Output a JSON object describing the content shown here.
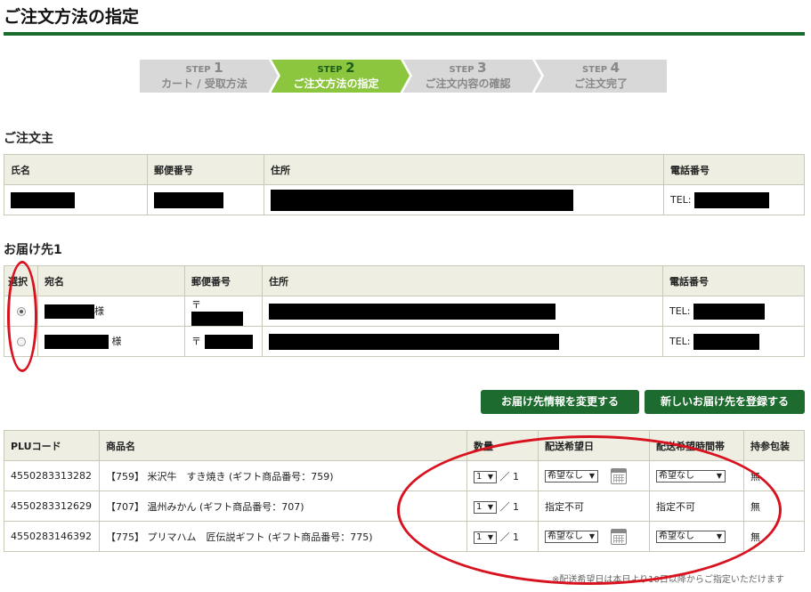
{
  "page": {
    "title": "ご注文方法の指定"
  },
  "steps": [
    {
      "label": "STEP",
      "num": "1",
      "name": "カート / 受取方法",
      "active": false
    },
    {
      "label": "STEP",
      "num": "2",
      "name": "ご注文方法の指定",
      "active": true
    },
    {
      "label": "STEP",
      "num": "3",
      "name": "ご注文内容の確認",
      "active": false
    },
    {
      "label": "STEP",
      "num": "4",
      "name": "ご注文完了",
      "active": false
    }
  ],
  "orderer": {
    "title": "ご注文主",
    "headers": {
      "name": "氏名",
      "zip": "郵便番号",
      "address": "住所",
      "phone": "電話番号"
    },
    "phone_prefix": "TEL:"
  },
  "delivery": {
    "title": "お届け先1",
    "headers": {
      "select": "選択",
      "name": "宛名",
      "zip": "郵便番号",
      "address": "住所",
      "phone": "電話番号"
    },
    "rows": [
      {
        "suffix": "様",
        "zip_prefix": "〒",
        "phone_prefix": "TEL:",
        "selected": true
      },
      {
        "suffix": "様",
        "zip_prefix": "〒",
        "phone_prefix": "TEL:",
        "selected": false
      }
    ]
  },
  "buttons": {
    "change": "お届け先情報を変更する",
    "new": "新しいお届け先を登録する"
  },
  "items": {
    "headers": {
      "plu": "PLUコード",
      "name": "商品名",
      "qty": "数量",
      "date": "配送希望日",
      "time": "配送希望時間帯",
      "wrap": "持参包装"
    },
    "rows": [
      {
        "plu": "4550283313282",
        "name": "【759】 米沢牛　すき焼き (ギフト商品番号：759)",
        "qty": "1",
        "qty_total": "／ 1",
        "date": "希望なし",
        "time": "希望なし",
        "wrap": "無",
        "selectable": true
      },
      {
        "plu": "4550283312629",
        "name": "【707】 温州みかん (ギフト商品番号：707)",
        "qty": "1",
        "qty_total": "／ 1",
        "date": "指定不可",
        "time": "指定不可",
        "wrap": "無",
        "selectable": false
      },
      {
        "plu": "4550283146392",
        "name": "【775】 プリマハム　匠伝説ギフト (ギフト商品番号：775)",
        "qty": "1",
        "qty_total": "／ 1",
        "date": "希望なし",
        "time": "希望なし",
        "wrap": "無",
        "selectable": true
      }
    ],
    "note": "※配送希望日は本日より10日以降からご指定いただけます"
  },
  "colors": {
    "brand_green": "#1a6b2e",
    "step_active": "#8cc63f",
    "annotation_red": "#d8121f"
  }
}
